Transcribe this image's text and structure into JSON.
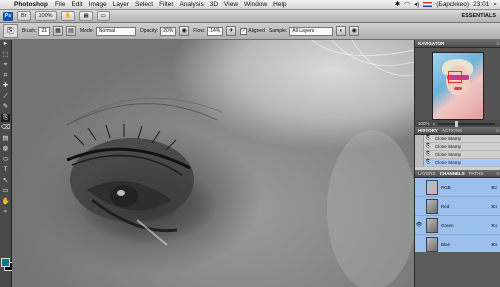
{
  "menubar": {
    "apple": "",
    "app": "Photoshop",
    "items": [
      "File",
      "Edit",
      "Image",
      "Layer",
      "Select",
      "Filter",
      "Analysis",
      "3D",
      "View",
      "Window",
      "Help"
    ],
    "user": "(Барckkeo)",
    "clock": "23:01"
  },
  "appbar": {
    "logo": "Ps",
    "zoom": "100%",
    "workspace": "ESSENTIALS"
  },
  "options": {
    "tool_icon": "stamp-icon",
    "brush_label": "Brush:",
    "brush_size": "21",
    "mode_label": "Mode:",
    "mode_value": "Normal",
    "opacity_label": "Opacity:",
    "opacity_value": "20%",
    "flow_label": "Flow:",
    "flow_value": "14%",
    "aligned_label": "Aligned",
    "sample_label": "Sample:",
    "sample_value": "All Layers"
  },
  "tools": [
    "▸",
    "⬚",
    "⌖",
    "⌗",
    "✚",
    "⟋",
    "✎",
    "⎘",
    "⌫",
    "▤",
    "◍",
    "⬭",
    "T",
    "↖",
    "▭",
    "✋",
    "⌕"
  ],
  "colors": {
    "foreground": "#0a7a82",
    "background": "#000000"
  },
  "navigator": {
    "title": "NAVIGATOR",
    "zoom": "100%"
  },
  "history": {
    "tabs": [
      "HISTORY",
      "ACTIONS"
    ],
    "rows": [
      "Clone Stamp",
      "Clone Stamp",
      "Clone Stamp",
      "Clone Stamp"
    ]
  },
  "layers": {
    "tabs": [
      "LAYERS",
      "CHANNELS",
      "PATHS"
    ],
    "channels": [
      {
        "name": "RGB",
        "shortcut": "⌘2"
      },
      {
        "name": "Red",
        "shortcut": "⌘3"
      },
      {
        "name": "Green",
        "shortcut": "⌘4"
      },
      {
        "name": "Blue",
        "shortcut": "⌘5"
      }
    ]
  }
}
